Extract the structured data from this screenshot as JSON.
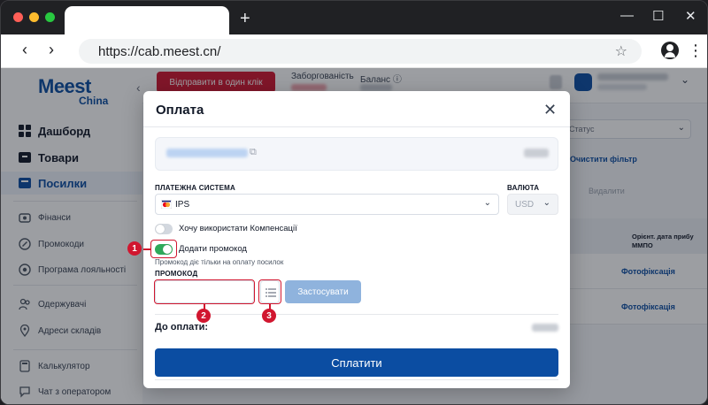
{
  "browser": {
    "url": "https://cab.meest.cn/",
    "new_tab_label": "+",
    "back": "‹",
    "forward": "›",
    "win_min": "—",
    "win_max": "☐",
    "win_close": "✕",
    "star": "☆",
    "menu": "⋮"
  },
  "sidebar": {
    "logo": "Meest",
    "logo_sub": "China",
    "collapse": "‹",
    "main_items": [
      {
        "label": "Дашборд",
        "icon": "grid-icon"
      },
      {
        "label": "Товари",
        "icon": "box-icon"
      },
      {
        "label": "Посилки",
        "icon": "parcel-icon"
      }
    ],
    "items": [
      {
        "label": "Фінанси",
        "icon": "finance-icon"
      },
      {
        "label": "Промокоди",
        "icon": "promo-icon"
      },
      {
        "label": "Програма лояльності",
        "icon": "loyalty-icon"
      },
      {
        "label": "Одержувачі",
        "icon": "recipients-icon"
      },
      {
        "label": "Адреси складів",
        "icon": "location-icon"
      },
      {
        "label": "Калькулятор",
        "icon": "calculator-icon"
      },
      {
        "label": "Чат з оператором",
        "icon": "chat-icon"
      }
    ]
  },
  "topbar": {
    "send_button": "Відправити в один клік",
    "debt_label": "Заборгованість",
    "balance_label": "Баланс",
    "info_icon": "ⓘ",
    "user_chevron": "⌄"
  },
  "background_right": {
    "status_placeholder": "Статус",
    "clear_filter": "Очистити фільтр",
    "delete": "Видалити",
    "col_header": "Орієнт. дата прибу ММПО",
    "row1_action": "Фотофіксація",
    "row2_action": "Фотофіксація"
  },
  "modal": {
    "title": "Оплата",
    "close": "✕",
    "copy_icon": "⧉",
    "payment_system_label": "ПЛАТЕЖНА СИСТЕМА",
    "payment_system_value": "IPS",
    "currency_label": "ВАЛЮТА",
    "currency_value": "USD",
    "chevron": "⌄",
    "compensation_toggle_label": "Хочу використати Компенсації",
    "promo_toggle_label": "Додати промокод",
    "promo_hint": "Промокод діє тільки на оплату посилок",
    "promo_label": "ПРОМОКОД",
    "promo_value": "",
    "apply_button": "Застосувати",
    "to_pay_label": "До оплати:",
    "pay_button": "Сплатити",
    "toggles": {
      "compensation": false,
      "promo": true
    }
  },
  "markers": [
    "1",
    "2",
    "3"
  ],
  "colors": {
    "brand_blue": "#0b4da2",
    "accent_red": "#d1162f",
    "toggle_on": "#2fa95a",
    "toggle_off": "#d3d8df",
    "apply_disabled": "#8fb3dd"
  }
}
